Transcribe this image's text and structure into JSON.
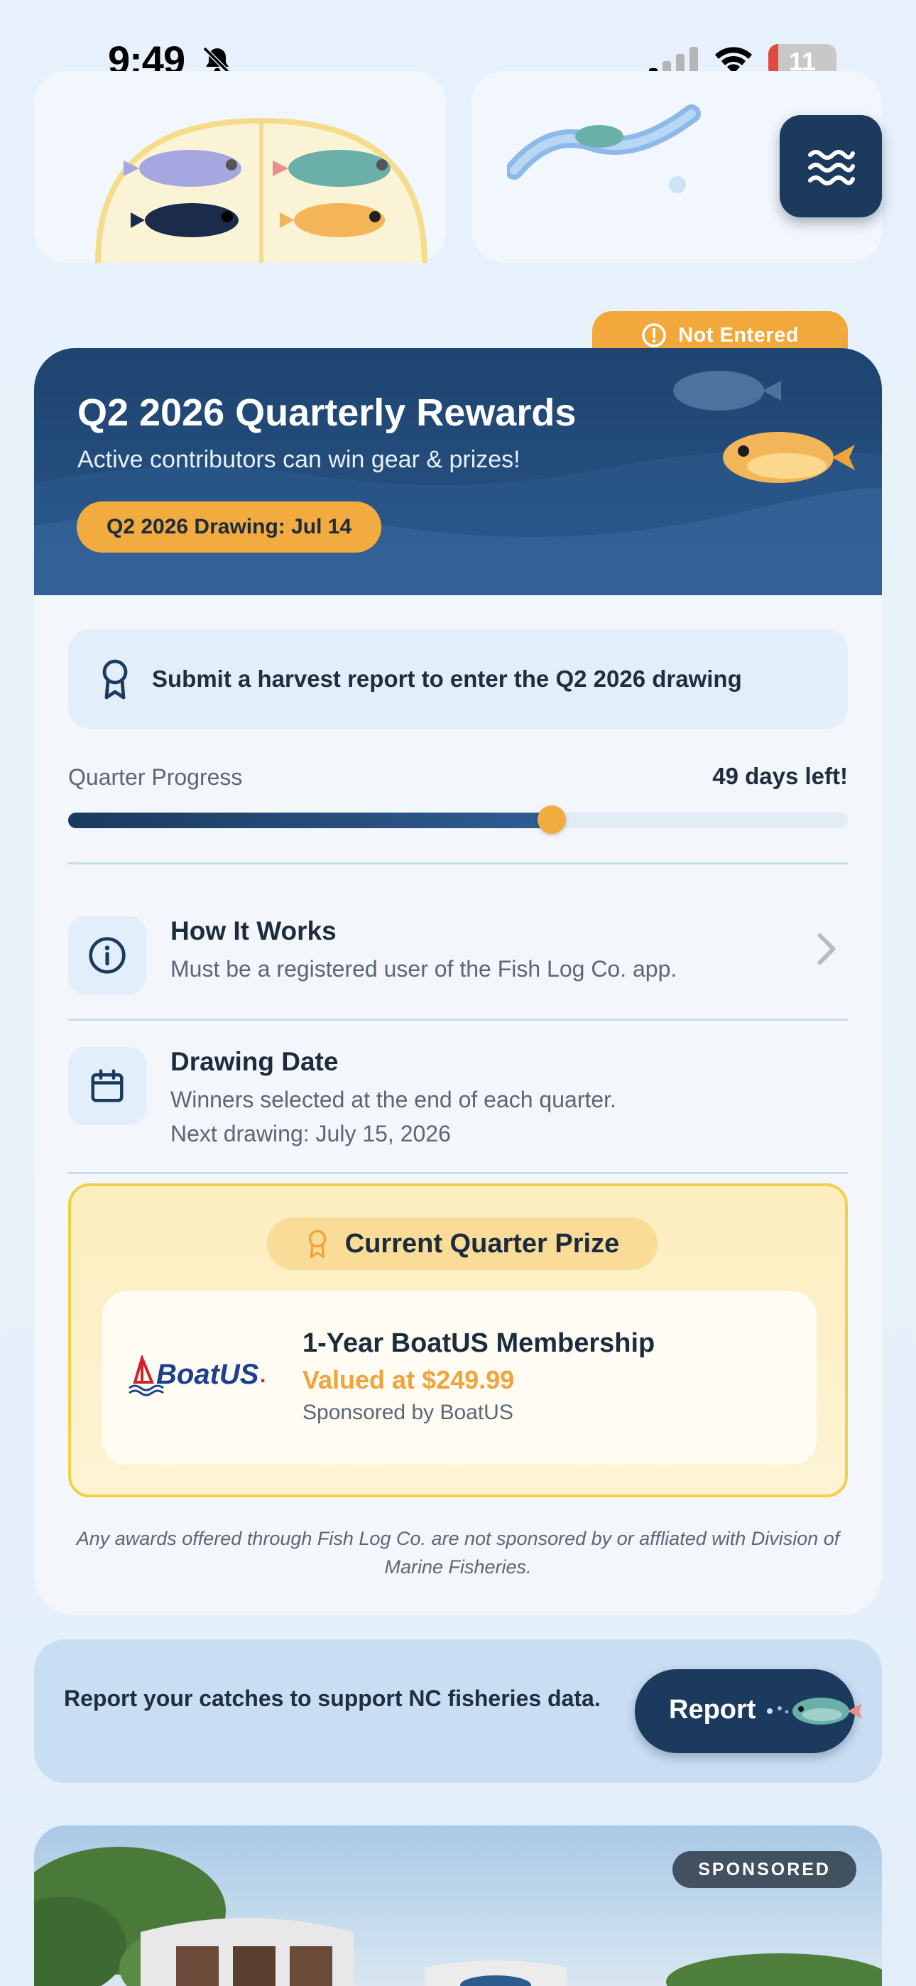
{
  "status_bar": {
    "time": "9:49",
    "battery": "11"
  },
  "rewards": {
    "entry_status": "Not Entered",
    "title": "Q2 2026 Quarterly Rewards",
    "subtitle": "Active contributors can win gear & prizes!",
    "drawing_pill": "Q2 2026 Drawing: Jul 14",
    "hint": "Submit a harvest report to enter the Q2 2026 drawing",
    "progress_label": "Quarter Progress",
    "days_left": "49 days left!",
    "progress_fraction": 0.62,
    "how_it_works": {
      "title": "How It Works",
      "desc": "Must be a registered user of the Fish Log Co. app."
    },
    "drawing_date": {
      "title": "Drawing Date",
      "desc_line1": "Winners selected at the end of each quarter.",
      "desc_line2": "Next drawing: July 15, 2026"
    },
    "prize": {
      "header": "Current Quarter Prize",
      "title": "1-Year BoatUS Membership",
      "value": "Valued at $249.99",
      "sponsor": "Sponsored by BoatUS",
      "logo_text": "BoatUS"
    },
    "disclaimer": "Any awards offered through Fish Log Co. are not sponsored by or affliated with Division of Marine Fisheries."
  },
  "report": {
    "text": "Report your catches to support NC fisheries data.",
    "button_label": "Report"
  },
  "sponsored": {
    "tag": "SPONSORED"
  },
  "colors": {
    "navy": "#1b3a5e",
    "accent_orange": "#f2ab3f",
    "prize_border": "#f5cf48",
    "battery_low": "#e04a3c"
  },
  "icons": [
    "bell-slash-icon",
    "signal-icon",
    "wifi-icon",
    "battery-icon",
    "waves-menu-icon",
    "alert-circle-icon",
    "ribbon-award-icon",
    "info-icon",
    "calendar-icon",
    "chevron-right-icon",
    "fish-icon"
  ]
}
